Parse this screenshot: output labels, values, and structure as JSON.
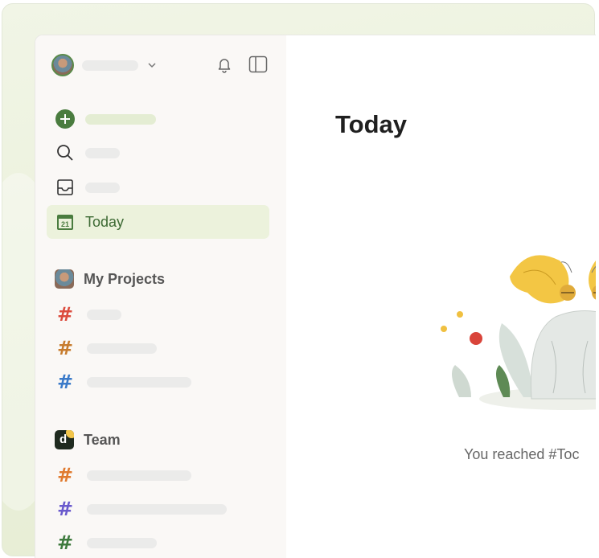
{
  "sidebar": {
    "user_name": "",
    "nav_items": [
      {
        "icon": "add-task-icon",
        "label": ""
      },
      {
        "icon": "search-icon",
        "label": ""
      },
      {
        "icon": "inbox-icon",
        "label": ""
      },
      {
        "icon": "calendar-today-icon",
        "label": "Today",
        "calendar_day": "21"
      }
    ],
    "sections": [
      {
        "title": "My Projects",
        "projects": [
          {
            "color": "#dc4c3e"
          },
          {
            "color": "#c77c2e"
          },
          {
            "color": "#3a7ac9"
          }
        ]
      },
      {
        "title": "Team",
        "team_avatar_letter": "d",
        "projects": [
          {
            "color": "#e07a2e"
          },
          {
            "color": "#6a5acd"
          },
          {
            "color": "#3d7a3d"
          }
        ]
      }
    ]
  },
  "main": {
    "title": "Today",
    "empty_message": "You reached #Toc"
  },
  "colors": {
    "accent": "#4a7c3f",
    "active_bg": "#ecf2dc",
    "sidebar_bg": "#faf8f6"
  }
}
